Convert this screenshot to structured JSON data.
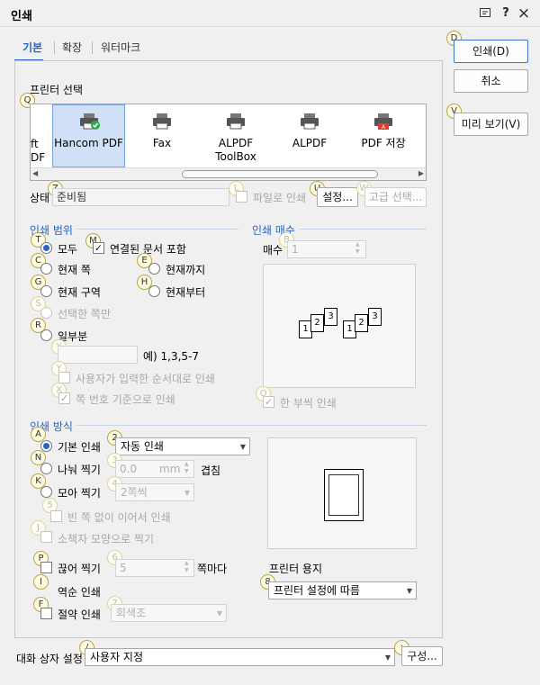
{
  "window": {
    "title": "인쇄",
    "controls": [
      "chat-icon",
      "help-icon",
      "close-icon"
    ],
    "help_glyph": "?",
    "close_glyph": "×"
  },
  "tabs": [
    {
      "label": "기본",
      "active": true
    },
    {
      "label": "확장"
    },
    {
      "label": "워터마크"
    }
  ],
  "right_buttons": {
    "print": "인쇄(D)",
    "cancel": "취소",
    "preview": "미리 보기(V)"
  },
  "keys": {
    "print": "D",
    "preview": "V",
    "printer_select": "Q",
    "status": "Z",
    "to_file": "L",
    "settings": "U",
    "advanced": "W",
    "all": "T",
    "linked": "M",
    "current_page": "C",
    "to_current": "E",
    "current_section": "G",
    "from_current": "H",
    "selected": "S",
    "partial": "R",
    "order": "Y",
    "page_order": "X",
    "copies": "B",
    "collate": "O",
    "basic_print": "A",
    "auto_mode": "2",
    "split": "N",
    "split_size": "3",
    "gather": "K",
    "gather_mode": "4",
    "no_blank": "5",
    "booklet": "J",
    "cut": "P",
    "cut_val": "6",
    "reverse": "I",
    "save": "F",
    "save_mode": "7",
    "paper": "8",
    "dialog": "/",
    "config": ";"
  },
  "printer_select": {
    "heading": "프린터 선택",
    "partial_left": [
      "ft",
      "DF"
    ],
    "printers": [
      {
        "name": "Hancom PDF",
        "selected": true
      },
      {
        "name": "Fax"
      },
      {
        "name": "ALPDF ToolBox"
      },
      {
        "name": "ALPDF"
      },
      {
        "name": "PDF 저장"
      }
    ]
  },
  "status": {
    "label": "상태",
    "value": "준비됨",
    "to_file": "파일로 인쇄",
    "settings_btn": "설정...",
    "advanced_btn": "고급 선택..."
  },
  "range": {
    "heading": "인쇄 범위",
    "all": "모두",
    "linked_docs": "연결된 문서 포함",
    "current_page": "현재 쪽",
    "to_current": "현재까지",
    "current_section": "현재 구역",
    "from_current": "현재부터",
    "selected_pages": "선택한 쪽만",
    "partial": "일부분",
    "partial_value": "",
    "partial_hint": "예) 1,3,5-7",
    "user_order": "사용자가 입력한 순서대로 인쇄",
    "page_order": "쪽 번호 기준으로 인쇄"
  },
  "copies": {
    "heading": "인쇄 매수",
    "label": "매수",
    "value": "1",
    "collate": "한 부씩 인쇄",
    "set1": [
      "1",
      "2",
      "3"
    ],
    "set2": [
      "1",
      "2",
      "3"
    ]
  },
  "method": {
    "heading": "인쇄 방식",
    "basic": "기본 인쇄",
    "basic_mode": "자동 인쇄",
    "split": "나눠 찍기",
    "split_value": "0.0",
    "split_unit": "mm",
    "split_suffix": "겹침",
    "gather": "모아 찍기",
    "gather_mode": "2쪽씩",
    "no_blank": "빈 쪽 없이 이어서 인쇄",
    "booklet": "소책자 모양으로 찍기",
    "cut": "끊어 찍기",
    "cut_value": "5",
    "cut_suffix": "쪽마다",
    "reverse": "역순 인쇄",
    "save": "절약 인쇄",
    "save_mode": "회색조",
    "paper_label": "프린터 용지",
    "paper_value": "프린터 설정에 따름"
  },
  "dialog_settings": {
    "label": "대화 상자 설정",
    "value": "사용자 지정",
    "config_btn": "구성..."
  }
}
